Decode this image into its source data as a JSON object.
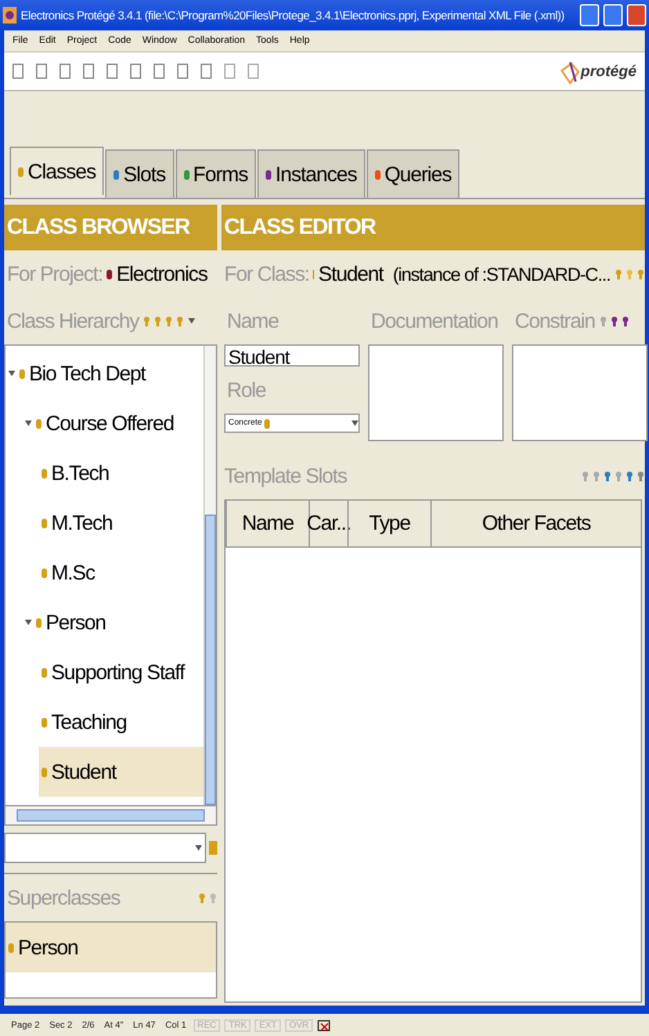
{
  "window": {
    "title": "Electronics  Protégé 3.4.1     (file:\\C:\\Program%20Files\\Protege_3.4.1\\Electronics.pprj, Experimental XML File (.xml))"
  },
  "menu": [
    "File",
    "Edit",
    "Project",
    "Code",
    "Window",
    "Collaboration",
    "Tools",
    "Help"
  ],
  "logo": "protégé",
  "tabs": [
    {
      "label": "Classes",
      "selected": true,
      "color": "#d4a017"
    },
    {
      "label": "Slots",
      "selected": false,
      "color": "#2a7fc0"
    },
    {
      "label": "Forms",
      "selected": false,
      "color": "#2e9a3a"
    },
    {
      "label": "Instances",
      "selected": false,
      "color": "#7a2a8a"
    },
    {
      "label": "Queries",
      "selected": false,
      "color": "#e8501a"
    }
  ],
  "browser": {
    "header": "CLASS BROWSER",
    "project_label": "For Project:",
    "project": "Electronics",
    "hierarchy_label": "Class Hierarchy",
    "tree": [
      {
        "label": "Bio Tech Dept",
        "expanded": true,
        "selected": false,
        "children": [
          {
            "label": "Course Offered",
            "expanded": true,
            "selected": false,
            "children": [
              {
                "label": "B.Tech",
                "selected": false
              },
              {
                "label": "M.Tech",
                "selected": false
              },
              {
                "label": "M.Sc",
                "selected": false
              }
            ]
          },
          {
            "label": "Person",
            "expanded": true,
            "selected": false,
            "children": [
              {
                "label": "Supporting Staff",
                "selected": false
              },
              {
                "label": "Teaching",
                "selected": false
              },
              {
                "label": "Student",
                "selected": true
              }
            ]
          }
        ]
      }
    ],
    "superclasses_label": "Superclasses",
    "superclasses": [
      {
        "label": "Person",
        "selected": true
      }
    ]
  },
  "editor": {
    "header": "CLASS EDITOR",
    "class_label": "For Class:",
    "class": "Student",
    "instance_of": "(instance of :STANDARD-C...",
    "name_label": "Name",
    "name_value": "Student",
    "documentation_label": "Documentation",
    "constraints_label": "Constrain",
    "role_label": "Role",
    "role_value": "Concrete",
    "template_slots_label": "Template Slots",
    "columns": [
      "Name",
      "Car...",
      "Type",
      "Other Facets"
    ]
  },
  "status_bar": [
    "Page 2",
    "Sec 2",
    "2/6",
    "At 4\"",
    "Ln 47",
    "Col 1",
    "REC",
    "TRK",
    "EXT",
    "OVR"
  ]
}
